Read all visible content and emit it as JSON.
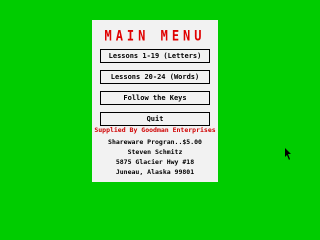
{
  "colors": {
    "background": "#00cc00",
    "panel": "#f2f2f2",
    "title": "#e00000",
    "supplied": "#d00000",
    "text": "#000000"
  },
  "menu": {
    "title": "MAIN MENU",
    "buttons": [
      "Lessons 1-19 (Letters)",
      "Lessons 20-24 (Words)",
      "Follow the Keys",
      "Quit"
    ],
    "supplied_by": "Supplied By Goodman Enterprises",
    "address": [
      "Shareware Progran..$5.00",
      "Steven Schmitz",
      "5875 Glacier Hwy #18",
      "Juneau, Alaska 99801"
    ]
  },
  "cursor": {
    "icon": "arrow-pointer-icon"
  }
}
